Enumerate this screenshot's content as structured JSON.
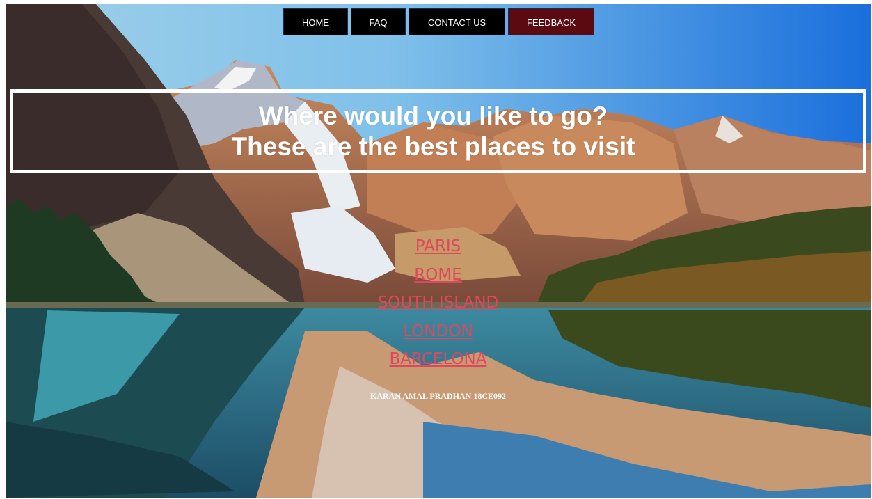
{
  "nav": {
    "items": [
      {
        "label": "HOME"
      },
      {
        "label": "FAQ"
      },
      {
        "label": "CONTACT US"
      },
      {
        "label": "FEEDBACK"
      }
    ],
    "active_color": "#5b0a12"
  },
  "hero": {
    "line1": "Where would you like to go?",
    "line2": "These are the best places to visit"
  },
  "places": {
    "items": [
      {
        "label": "PARIS"
      },
      {
        "label": "ROME"
      },
      {
        "label": "SOUTH ISLAND"
      },
      {
        "label": "LONDON"
      },
      {
        "label": "BARCELONA"
      }
    ],
    "link_color": "#e0475d"
  },
  "footer": {
    "credit": "KARAN AMAL PRADHAN 18CE092"
  },
  "background": {
    "icon": "mountain-lake-landscape"
  }
}
